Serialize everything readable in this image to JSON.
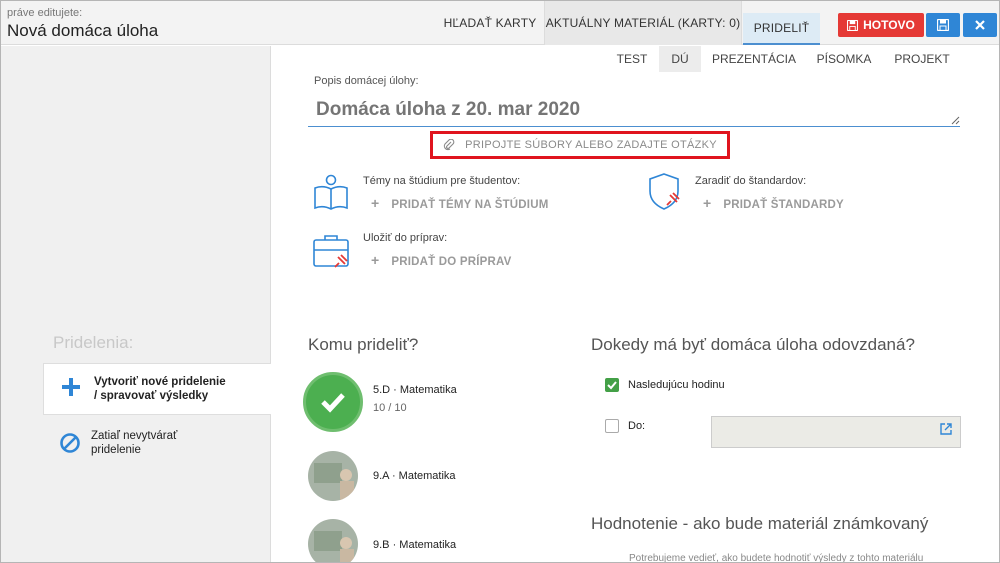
{
  "header": {
    "caption": "práve editujete:",
    "title": "Nová domáca úloha",
    "tabs": {
      "search": "HĽADAŤ KARTY",
      "material": "AKTUÁLNY MATERIÁL (KARTY: 0)",
      "assign": "PRIDELIŤ"
    },
    "done_label": "HOTOVO",
    "colors": {
      "done": "#e53935",
      "action": "#2f86d6"
    },
    "icons": {
      "done": "save-icon",
      "save": "save-icon",
      "close": "close-icon"
    }
  },
  "sidebar": {
    "heading": "Pridelenia:",
    "items": [
      {
        "label_line1": "Vytvoriť nové pridelenie",
        "label_line2": "/ spravovať výsledky",
        "icon": "plus-icon"
      },
      {
        "label_line1": "Zatiaľ nevytvárať",
        "label_line2": "pridelenie",
        "icon": "ban-icon"
      }
    ]
  },
  "type_tabs": [
    "TEST",
    "DÚ",
    "PREZENTÁCIA",
    "PÍSOMKA",
    "PROJEKT"
  ],
  "form": {
    "description_label": "Popis domácej úlohy:",
    "description_placeholder": "Domáca úloha z 20. mar 2020",
    "attach_label": "PRIPOJTE SÚBORY ALEBO ZADAJTE OTÁZKY",
    "topics_label": "Témy na štúdium pre študentov:",
    "topics_action": "PRIDAŤ TÉMY NA ŠTÚDIUM",
    "standards_label": "Zaradiť do štandardov:",
    "standards_action": "PRIDAŤ ŠTANDARDY",
    "prep_label": "Uložiť do príprav:",
    "prep_action": "PRIDAŤ DO PRÍPRAV"
  },
  "assign": {
    "heading": "Komu prideliť?",
    "classes": [
      {
        "name": "5.D · Matematika",
        "count": "10 / 10",
        "selected": true
      },
      {
        "name": "9.A · Matematika",
        "count": "",
        "selected": false
      },
      {
        "name": "9.B · Matematika",
        "count": "",
        "selected": false
      }
    ]
  },
  "deadline": {
    "heading": "Dokedy má byť domáca úloha odovzdaná?",
    "next_lesson_label": "Nasledujúcu hodinu",
    "next_lesson_checked": true,
    "until_label": "Do:",
    "until_checked": false
  },
  "grading": {
    "heading": "Hodnotenie - ako bude materiál známkovaný",
    "note": "Potrebujeme vedieť, ako budete hodnotiť výsledy z tohto materiálu"
  }
}
